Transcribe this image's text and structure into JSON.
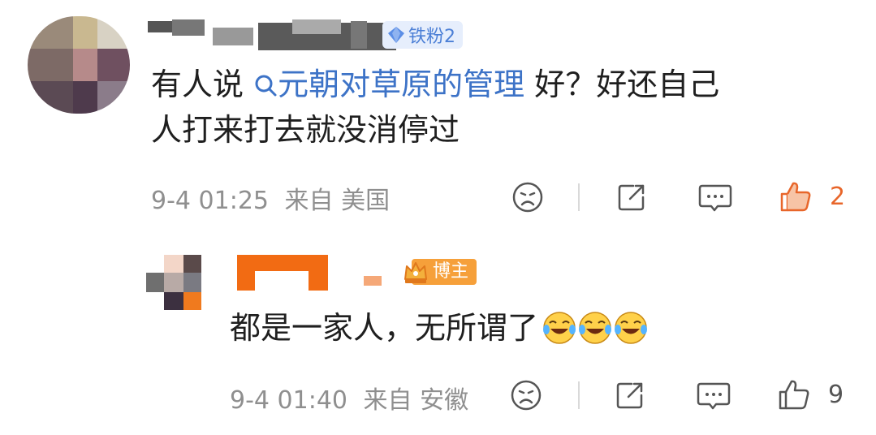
{
  "comment1": {
    "username": "刷部※ ▇▇▇ 捣",
    "badge": "铁粉2",
    "text_prefix": "有人说",
    "topic": "元朝对草原的管理",
    "text_line1_rest": "好？好还自己",
    "text_line2": "人打来打去就没消停过",
    "time": "9-4 01:25",
    "source": "来自 美国",
    "like_count": "2",
    "liked": true
  },
  "reply1": {
    "username": "▇▇▇",
    "badge": "博主",
    "text": "都是一家人，无所谓了",
    "emoji": [
      "laugh-cry",
      "laugh-cry",
      "laugh-cry"
    ],
    "time": "9-4 01:40",
    "source": "来自 安徽",
    "like_count": "9",
    "liked": false
  },
  "colors": {
    "accent_like": "#e8662a",
    "topic_blue": "#3d73c7",
    "meta_gray": "#8f8f8f",
    "host_orange": "#f6a03a"
  }
}
